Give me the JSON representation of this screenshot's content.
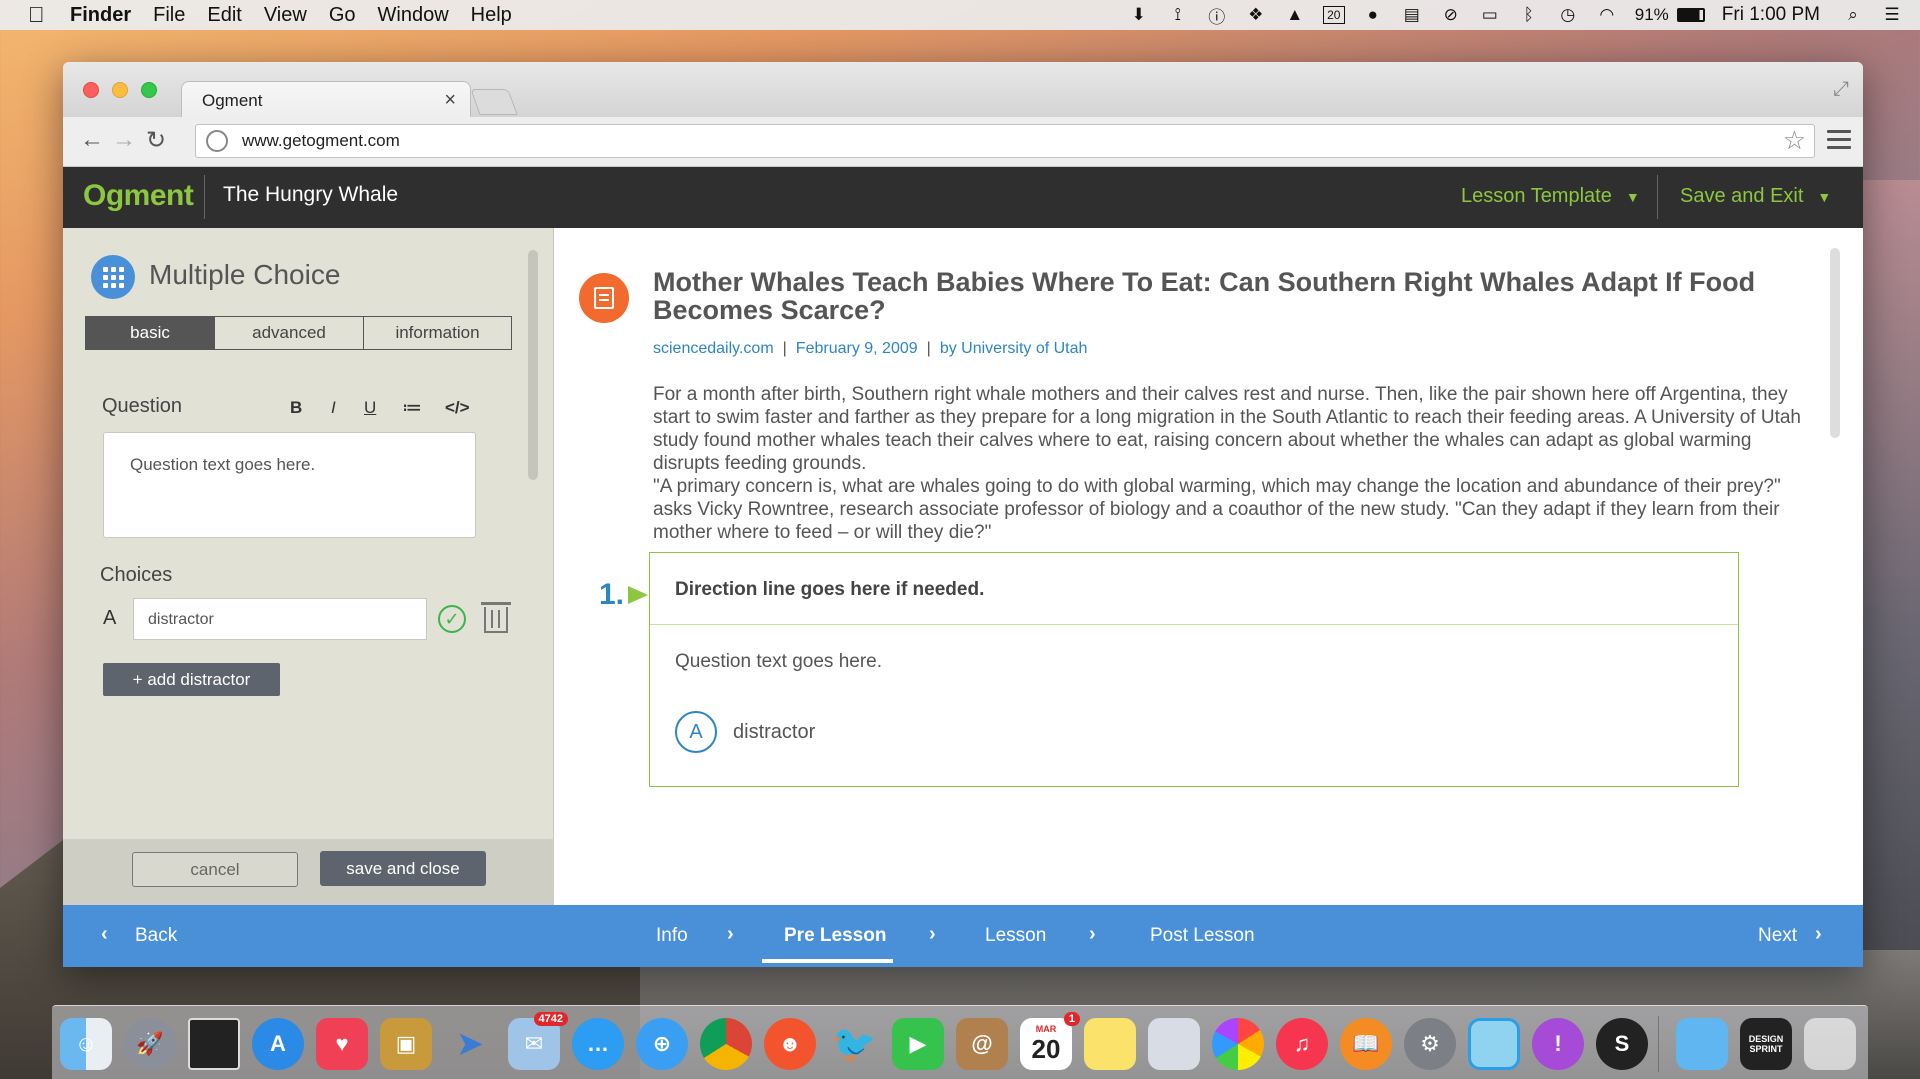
{
  "menubar": {
    "app": "Finder",
    "items": [
      "File",
      "Edit",
      "View",
      "Go",
      "Window",
      "Help"
    ],
    "calendar_day": "20",
    "battery": "91%",
    "clock": "Fri 1:00 PM"
  },
  "browser": {
    "tab_title": "Ogment",
    "tab_close": "×",
    "url": "www.getogment.com"
  },
  "app": {
    "logo": "Ogment",
    "lesson_title": "The Hungry Whale",
    "lesson_template_label": "Lesson Template",
    "save_exit_label": "Save and Exit"
  },
  "editor": {
    "title": "Multiple Choice",
    "tabs": [
      "basic",
      "advanced",
      "information"
    ],
    "question_label": "Question",
    "format": {
      "bold": "B",
      "italic": "I",
      "underline": "U",
      "list": "≔",
      "code": "</>"
    },
    "question_placeholder": "Question text goes here.",
    "choices_label": "Choices",
    "choice_letter": "A",
    "choice_value": "distractor",
    "add_distractor": "+ add distractor",
    "cancel": "cancel",
    "save_close": "save and close"
  },
  "article": {
    "title": "Mother Whales Teach Babies Where To Eat: Can Southern Right Whales Adapt If Food Becomes Scarce?",
    "source": "sciencedaily.com",
    "date": "February 9, 2009",
    "author": "by University of Utah",
    "paragraph1": "For a month after birth, Southern right whale mothers and their calves rest and nurse. Then, like the pair shown here off Argentina, they start to swim faster and farther as they prepare for a long migration in the South Atlantic to reach their feeding areas. A University of Utah study found mother whales teach their calves where to eat, raising concern about whether the whales can adapt as global warming disrupts feeding grounds.",
    "paragraph2": "\"A primary concern is, what are whales going to do with global warming, which may change the location and abundance of their prey?\" asks Vicky Rowntree, research associate professor of biology and a coauthor of the new study. \"Can they adapt if they learn from their mother where to feed – or will they die?\""
  },
  "preview": {
    "number": "1.",
    "direction": "Direction line goes here if needed.",
    "question": "Question text goes here.",
    "option_letter": "A",
    "option_text": "distractor"
  },
  "bottomnav": {
    "back": "Back",
    "steps": [
      "Info",
      "Pre Lesson",
      "Lesson",
      "Post Lesson"
    ],
    "active_step": "Pre Lesson",
    "next": "Next"
  },
  "dock": {
    "mail_badge": "4742",
    "calendar_month": "MAR",
    "calendar_day": "20",
    "calendar_badge": "1",
    "design_sprint": "DESIGN SPRINT"
  },
  "colors": {
    "brand_green": "#8dc63f",
    "accent_blue": "#4a90d9",
    "link_blue": "#2e86c1",
    "article_orange": "#f26a2e"
  }
}
